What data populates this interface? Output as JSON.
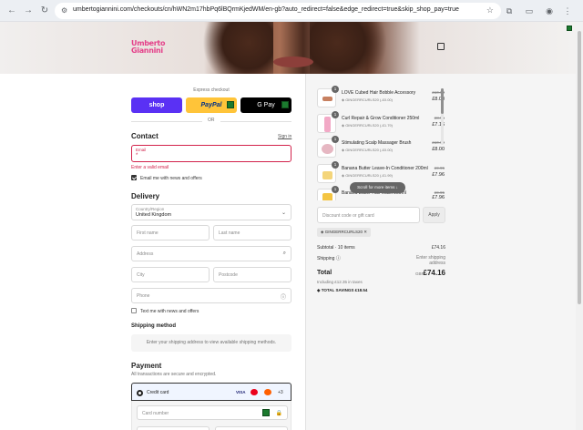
{
  "browser": {
    "url": "umbertogiannini.com/checkouts/cn/hWN2m17hbPq6lBQrmKjedWM/en-gb?auto_redirect=false&edge_redirect=true&skip_shop_pay=true"
  },
  "brand": {
    "logo_line1": "Umberto",
    "logo_line2": "Giannini"
  },
  "express": {
    "label": "Express checkout",
    "shop_label": "shop",
    "paypal_label": "PayPal",
    "gpay_label": "G Pay",
    "or_label": "OR"
  },
  "contact": {
    "heading": "Contact",
    "signin": "Sign in",
    "email_label": "Email",
    "email_value": "*",
    "error": "Enter a valid email",
    "newsletter": "Email me with news and offers"
  },
  "delivery": {
    "heading": "Delivery",
    "country_label": "Country/Region",
    "country_value": "United Kingdom",
    "first_name": "First name",
    "last_name": "Last name",
    "address": "Address",
    "city": "City",
    "postcode": "Postcode",
    "phone": "Phone",
    "text_me": "Text me with news and offers"
  },
  "shipping": {
    "heading": "Shipping method",
    "placeholder": "Enter your shipping address to view available shipping methods."
  },
  "payment": {
    "heading": "Payment",
    "secure": "All transactions are secure and encrypted.",
    "credit_card": "Credit card",
    "visa": "VISA",
    "more": "+3",
    "card_number": "Card number"
  },
  "cart": {
    "items": [
      {
        "qty": "1",
        "name": "LOVE Cubed Hair Bobble Accessory",
        "code": "GINGERRCURLS20 (-£0.00)",
        "old": "£10.00",
        "new": "£8.00"
      },
      {
        "qty": "1",
        "name": "Curl Repair & Grow Conditioner 250ml",
        "code": "GINGERRCURLS20 (-£1.79)",
        "old": "£8.95",
        "new": "£7.16"
      },
      {
        "qty": "1",
        "name": "Stimulating Scalp Massager Brush",
        "code": "GINGERRCURLS20 (-£0.00)",
        "old": "£10.00",
        "new": "£8.00"
      },
      {
        "qty": "1",
        "name": "Banana Butter Leave-In Conditioner 200ml",
        "code": "GINGERRCURLS20 (-£1.99)",
        "old": "£9.95",
        "new": "£7.96"
      },
      {
        "qty": "1",
        "name": "Banana Butter Hair Mask 250ml",
        "code": "",
        "old": "£9.95",
        "new": "£7.96"
      }
    ],
    "scroll_hint": "Scroll for more items",
    "discount_placeholder": "Discount code or gift card",
    "apply": "Apply",
    "applied_code": "GINGERRCURLS20",
    "subtotal_label": "Subtotal · 10 items",
    "subtotal_value": "£74.16",
    "shipping_label": "Shipping",
    "shipping_value": "Enter shipping address",
    "total_label": "Total",
    "currency": "GBP",
    "total_value": "£74.16",
    "tax": "Including £12.35 in taxes",
    "savings": "TOTAL SAVINGS £18.54"
  }
}
